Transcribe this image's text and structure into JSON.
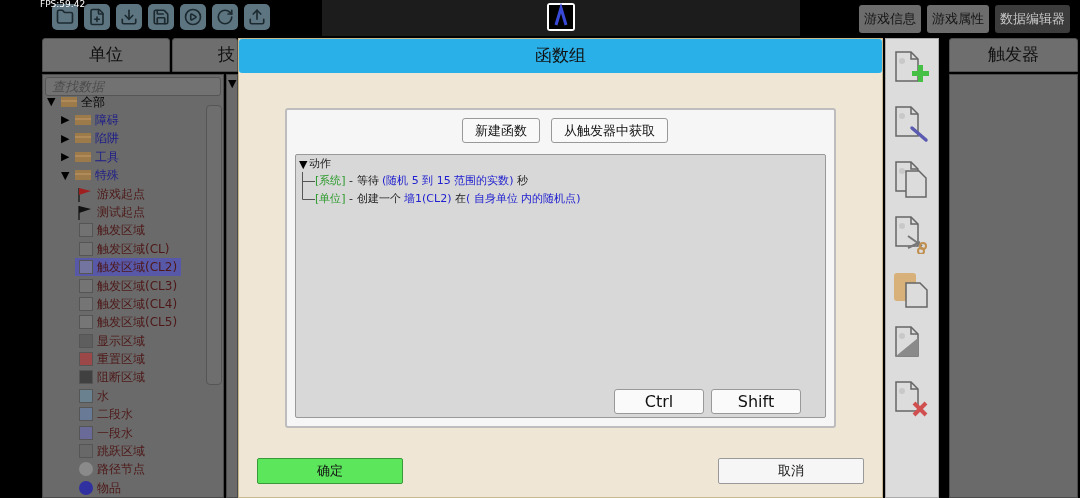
{
  "fps": "FPS:59.42",
  "toolbar": [
    {
      "kind": "folder"
    },
    {
      "kind": "new-file"
    },
    {
      "kind": "download"
    },
    {
      "kind": "save"
    },
    {
      "kind": "play"
    },
    {
      "kind": "refresh"
    },
    {
      "kind": "upload"
    }
  ],
  "top_buttons": [
    {
      "label": "游戏信息",
      "selected": false
    },
    {
      "label": "游戏属性",
      "selected": false
    },
    {
      "label": "数据编辑器",
      "selected": true
    }
  ],
  "tabs": [
    {
      "label": "单位"
    },
    {
      "label": "技"
    }
  ],
  "right_tab": {
    "label": "触发器"
  },
  "search": {
    "placeholder": "查找数据"
  },
  "second_panel": {
    "toggle": "▼"
  },
  "tree": [
    {
      "label": "全部",
      "toggle": "▼",
      "expanded": true,
      "children": [
        {
          "label": "障碍",
          "toggle": "▶",
          "expanded": false
        },
        {
          "label": "陷阱",
          "toggle": "▶",
          "expanded": false
        },
        {
          "label": "工具",
          "toggle": "▶",
          "expanded": false
        },
        {
          "label": "特殊",
          "toggle": "▼",
          "expanded": true,
          "children": [
            {
              "label": "游戏起点",
              "kind": "flag",
              "color": "#a02020",
              "selected": false
            },
            {
              "label": "测试起点",
              "kind": "flag",
              "color": "#111111",
              "selected": false
            },
            {
              "label": "触发区域",
              "kind": "swatch",
              "color": "#727272",
              "selected": false
            },
            {
              "label": "触发区域(CL)",
              "kind": "swatch",
              "color": "#737373",
              "selected": false
            },
            {
              "label": "触发区域(CL2)",
              "kind": "swatch",
              "color": "#7474a0",
              "selected": true
            },
            {
              "label": "触发区域(CL3)",
              "kind": "swatch",
              "color": "#747474",
              "selected": false
            },
            {
              "label": "触发区域(CL4)",
              "kind": "swatch",
              "color": "#757575",
              "selected": false
            },
            {
              "label": "触发区域(CL5)",
              "kind": "swatch",
              "color": "#767676",
              "selected": false
            },
            {
              "label": "显示区域",
              "kind": "swatch",
              "color": "#5e5e5e",
              "selected": false
            },
            {
              "label": "重置区域",
              "kind": "swatch",
              "color": "#9c4848",
              "selected": false
            },
            {
              "label": "阻断区域",
              "kind": "swatch",
              "color": "#404040",
              "selected": false
            },
            {
              "label": "水",
              "kind": "swatch",
              "color": "#6a8290",
              "selected": false
            },
            {
              "label": "二段水",
              "kind": "swatch",
              "color": "#687a96",
              "selected": false
            },
            {
              "label": "一段水",
              "kind": "swatch",
              "color": "#6a6a98",
              "selected": false
            },
            {
              "label": "跳跃区域",
              "kind": "swatch",
              "color": "#686868",
              "selected": false
            },
            {
              "label": "路径节点",
              "kind": "node",
              "color": "#8a8a8a",
              "selected": false
            },
            {
              "label": "物品",
              "kind": "node",
              "color": "#3030a0",
              "selected": false
            }
          ]
        }
      ]
    }
  ],
  "dialog": {
    "title": "函数组",
    "buttons": [
      {
        "label": "新建函数"
      },
      {
        "label": "从触发器中获取"
      }
    ],
    "action_group": {
      "label": "动作",
      "toggle": "▼",
      "lines": [
        {
          "segments": [
            {
              "kind": "category",
              "text": "[系统]"
            },
            {
              "kind": "plain",
              "text": " - 等待 "
            },
            {
              "kind": "param",
              "text": "(随机 5 到 15 范围的实数)"
            },
            {
              "kind": "plain",
              "text": " 秒"
            }
          ]
        },
        {
          "segments": [
            {
              "kind": "category",
              "text": "[单位]"
            },
            {
              "kind": "plain",
              "text": " - 创建一个 "
            },
            {
              "kind": "param",
              "text": "墙1(CL2)"
            },
            {
              "kind": "plain",
              "text": " 在"
            },
            {
              "kind": "param",
              "text": "( 自身单位 内的随机点)"
            }
          ]
        }
      ]
    },
    "modifier_keys": [
      {
        "label": "Ctrl"
      },
      {
        "label": "Shift"
      }
    ],
    "ok": "确定",
    "cancel": "取消"
  },
  "side_tools": [
    {
      "kind": "add"
    },
    {
      "kind": "edit"
    },
    {
      "kind": "copy"
    },
    {
      "kind": "cut"
    },
    {
      "kind": "paste"
    },
    {
      "kind": "blank"
    },
    {
      "kind": "delete"
    }
  ]
}
